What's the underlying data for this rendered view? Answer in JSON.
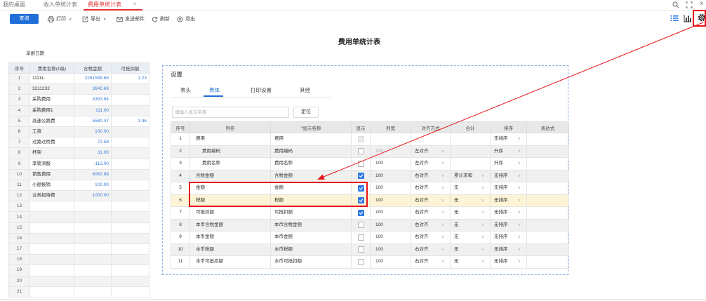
{
  "tabs": [
    {
      "label": "我的桌面",
      "active": false
    },
    {
      "label": "收入单统计表",
      "active": false
    },
    {
      "label": "费用单统计表",
      "active": true,
      "close": "×"
    }
  ],
  "window_controls": {
    "icons": [
      "search-icon",
      "maximize-icon",
      "close-icon"
    ],
    "close_glyph": "×"
  },
  "toolbar": {
    "query_label": "查询",
    "print_label": "打印",
    "export_label": "导出",
    "email_label": "发送邮件",
    "refresh_label": "刷新",
    "exit_label": "退出",
    "dropdown_glyph": "∨",
    "icons": [
      "printer-icon",
      "export-icon",
      "mail-icon",
      "refresh-icon",
      "exit-icon"
    ],
    "right_icons": [
      "list-view-icon",
      "bar-chart-icon",
      "gear-icon"
    ]
  },
  "report": {
    "title": "费用单统计表",
    "date_label": "单据日期"
  },
  "left_table": {
    "headers": [
      "序号",
      "费用名称(1级)",
      "含税金额",
      "可抵扣额"
    ],
    "rows": [
      {
        "no": "1",
        "name": "11111-",
        "amount": "2261599.68",
        "deductible": "1.23"
      },
      {
        "no": "2",
        "name": "3211232",
        "amount": "3640.69",
        "deductible": ""
      },
      {
        "no": "3",
        "name": "采购费用",
        "amount": "3393.84",
        "deductible": ""
      },
      {
        "no": "4",
        "name": "采购费用1",
        "amount": "111.00",
        "deductible": ""
      },
      {
        "no": "5",
        "name": "高速公路费",
        "amount": "5580.47",
        "deductible": "1.46"
      },
      {
        "no": "6",
        "name": "工资",
        "amount": "100.00",
        "deductible": ""
      },
      {
        "no": "7",
        "name": "过路过桥费",
        "amount": "72.58",
        "deductible": ""
      },
      {
        "no": "8",
        "name": "杯架",
        "amount": "11.00",
        "deductible": ""
      },
      {
        "no": "9",
        "name": "李警测服",
        "amount": "-113.00",
        "deductible": ""
      },
      {
        "no": "10",
        "name": "销售费用",
        "amount": "6062.88",
        "deductible": ""
      },
      {
        "no": "11",
        "name": "小额报销",
        "amount": "100.00",
        "deductible": ""
      },
      {
        "no": "12",
        "name": "业务招待费",
        "amount": "1000.00",
        "deductible": ""
      },
      {
        "no": "13",
        "name": "",
        "amount": "",
        "deductible": ""
      },
      {
        "no": "14",
        "name": "",
        "amount": "",
        "deductible": ""
      },
      {
        "no": "15",
        "name": "",
        "amount": "",
        "deductible": ""
      },
      {
        "no": "16",
        "name": "",
        "amount": "",
        "deductible": ""
      },
      {
        "no": "17",
        "name": "",
        "amount": "",
        "deductible": ""
      },
      {
        "no": "18",
        "name": "",
        "amount": "",
        "deductible": ""
      },
      {
        "no": "19",
        "name": "",
        "amount": "",
        "deductible": ""
      },
      {
        "no": "20",
        "name": "",
        "amount": "",
        "deductible": ""
      },
      {
        "no": "21",
        "name": "",
        "amount": "",
        "deductible": ""
      }
    ]
  },
  "settings": {
    "title": "设置",
    "tabs": [
      {
        "label": "表头",
        "active": false
      },
      {
        "label": "表体",
        "active": true
      },
      {
        "label": "打印设置",
        "active": false
      },
      {
        "label": "其他",
        "active": false
      }
    ],
    "search_placeholder": "请输入显示名称",
    "locate_label": "定位",
    "headers": [
      "序号",
      "列名",
      "*显示名称",
      "显示",
      "列宽",
      "对齐方式",
      "合计",
      "排序",
      "表达式"
    ],
    "dropdown_glyph": "∨",
    "rows": [
      {
        "no": "1",
        "col": "费用",
        "display": "费用",
        "level": 1,
        "show": false,
        "show_enabled": false,
        "width": "",
        "align": "",
        "sum": "",
        "sort": "无排序",
        "expr": "",
        "selected": false
      },
      {
        "no": "2",
        "col": "费用编码",
        "display": "费用编码",
        "level": 2,
        "show": false,
        "show_enabled": true,
        "width": "100",
        "align": "左对齐",
        "sum": "",
        "sort": "升序",
        "expr": "",
        "selected": false
      },
      {
        "no": "3",
        "col": "费用名称",
        "display": "费用名称",
        "level": 2,
        "show": false,
        "show_enabled": true,
        "width": "100",
        "align": "左对齐",
        "sum": "",
        "sort": "升序",
        "expr": "",
        "selected": false
      },
      {
        "no": "4",
        "col": "含税金额",
        "display": "含税金额",
        "level": 1,
        "show": true,
        "show_enabled": true,
        "width": "100",
        "align": "右对齐",
        "sum": "累计求和",
        "sort": "无排序",
        "expr": "",
        "selected": false
      },
      {
        "no": "5",
        "col": "金额",
        "display": "金额",
        "level": 1,
        "show": true,
        "show_enabled": true,
        "width": "100",
        "align": "右对齐",
        "sum": "无",
        "sort": "无排序",
        "expr": "",
        "selected": false
      },
      {
        "no": "6",
        "col": "税额",
        "display": "税额",
        "level": 1,
        "show": true,
        "show_enabled": true,
        "width": "100",
        "align": "右对齐",
        "sum": "无",
        "sort": "无排序",
        "expr": "",
        "selected": true
      },
      {
        "no": "7",
        "col": "可抵扣额",
        "display": "可抵扣额",
        "level": 1,
        "show": true,
        "show_enabled": true,
        "width": "100",
        "align": "右对齐",
        "sum": "无",
        "sort": "无排序",
        "expr": "",
        "selected": false
      },
      {
        "no": "8",
        "col": "本币含税金额",
        "display": "本币含税金额",
        "level": 1,
        "show": false,
        "show_enabled": true,
        "width": "100",
        "align": "右对齐",
        "sum": "无",
        "sort": "无排序",
        "expr": "",
        "selected": false
      },
      {
        "no": "9",
        "col": "本币金额",
        "display": "本币金额",
        "level": 1,
        "show": false,
        "show_enabled": true,
        "width": "100",
        "align": "右对齐",
        "sum": "无",
        "sort": "无排序",
        "expr": "",
        "selected": false
      },
      {
        "no": "10",
        "col": "本币税额",
        "display": "本币税额",
        "level": 1,
        "show": false,
        "show_enabled": true,
        "width": "100",
        "align": "右对齐",
        "sum": "无",
        "sort": "无排序",
        "expr": "",
        "selected": false
      },
      {
        "no": "11",
        "col": "本币可抵扣额",
        "display": "本币可抵扣额",
        "level": 1,
        "show": false,
        "show_enabled": true,
        "width": "100",
        "align": "右对齐",
        "sum": "无",
        "sort": "无排序",
        "expr": "",
        "selected": false
      }
    ]
  },
  "colors": {
    "primary": "#1f6fd8",
    "active_tab": "#e0312f",
    "annotation": "#e8141b",
    "number_text": "#3a7bd5",
    "selected_row": "#fdf4d5",
    "checkbox": "#2f7be5"
  }
}
